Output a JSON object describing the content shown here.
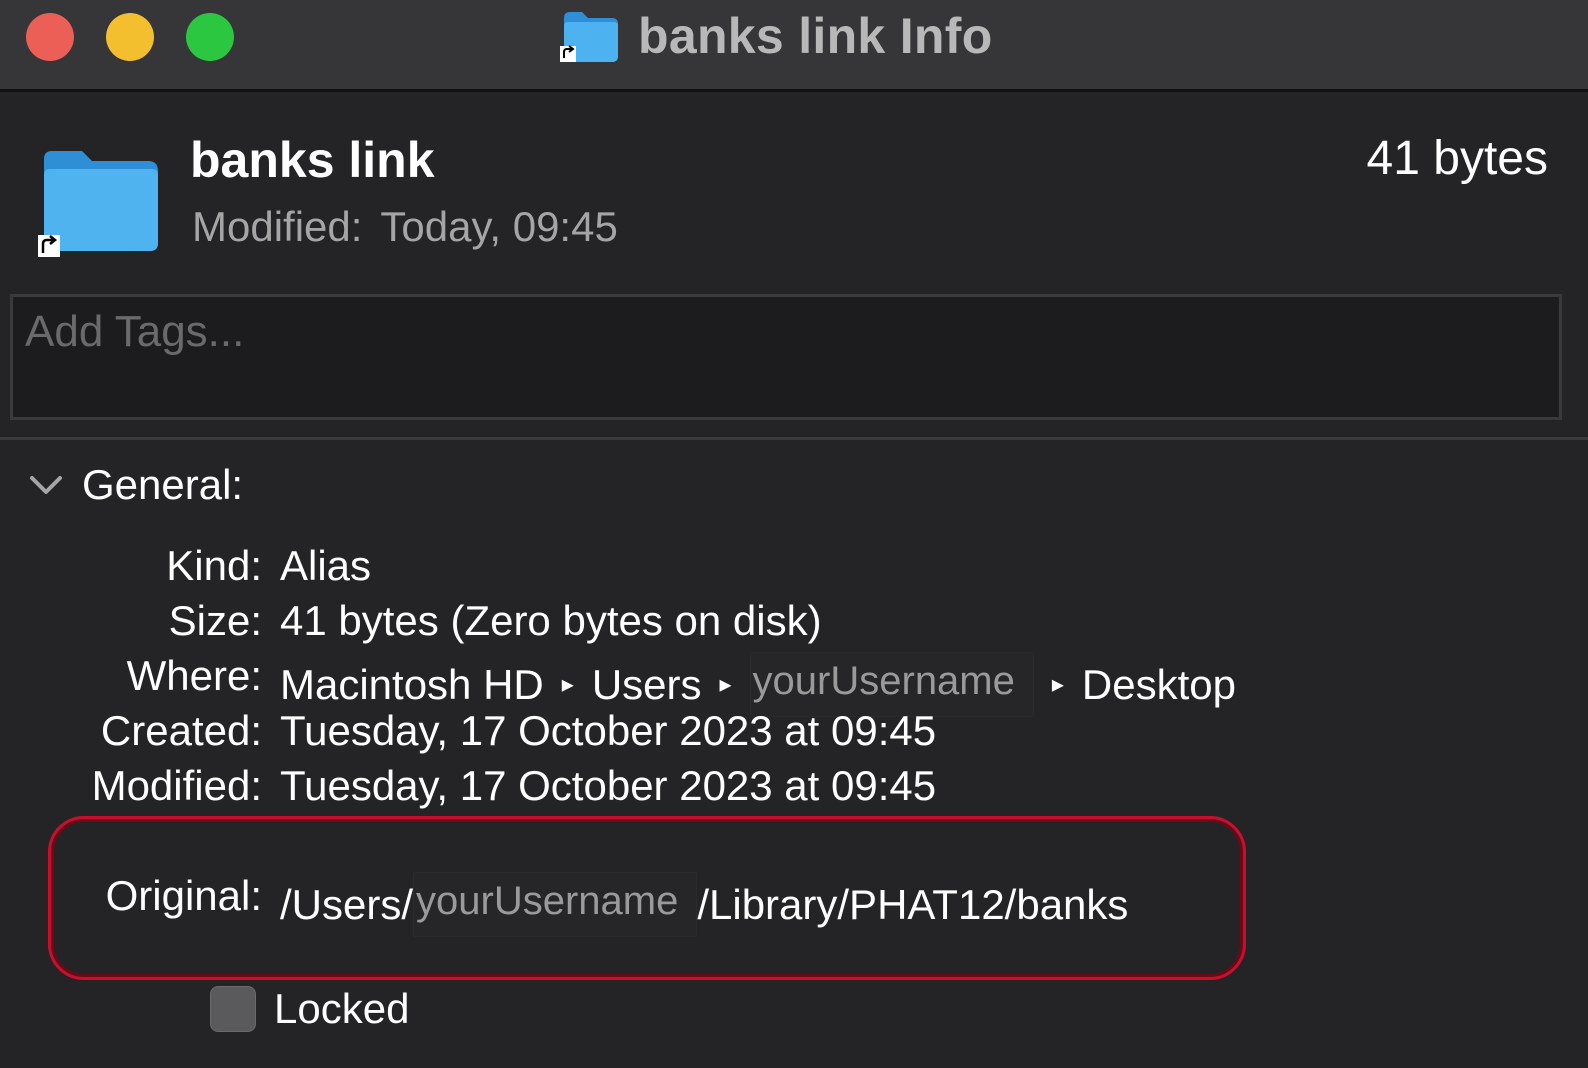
{
  "window": {
    "title": "banks link Info"
  },
  "header": {
    "name": "banks link",
    "size": "41 bytes",
    "modified_label": "Modified:",
    "modified_value": "Today, 09:45"
  },
  "tags": {
    "placeholder": "Add Tags..."
  },
  "general": {
    "section_label": "General:",
    "kind_label": "Kind:",
    "kind_value": "Alias",
    "size_label": "Size:",
    "size_value": "41 bytes (Zero bytes on disk)",
    "where_label": "Where:",
    "where_path": [
      "Macintosh HD",
      "Users",
      "yourUsername",
      "Desktop"
    ],
    "created_label": "Created:",
    "created_value": "Tuesday, 17 October 2023 at 09:45",
    "modified_label": "Modified:",
    "modified_value": "Tuesday, 17 October 2023 at 09:45",
    "original_label": "Original:",
    "original_prefix": "/Users/",
    "original_user": "yourUsername",
    "original_suffix": "/Library/PHAT12/banks",
    "locked_label": "Locked",
    "locked_checked": false
  },
  "colors": {
    "close": "#ec5f57",
    "minimize": "#f4bf2e",
    "zoom": "#2cc741",
    "folder_blue": "#3aa6e8",
    "highlight": "#c8102e"
  },
  "icons": {
    "folder": "folder-alias-icon",
    "disclosure": "chevron-down-icon",
    "path_separator": "▸"
  }
}
